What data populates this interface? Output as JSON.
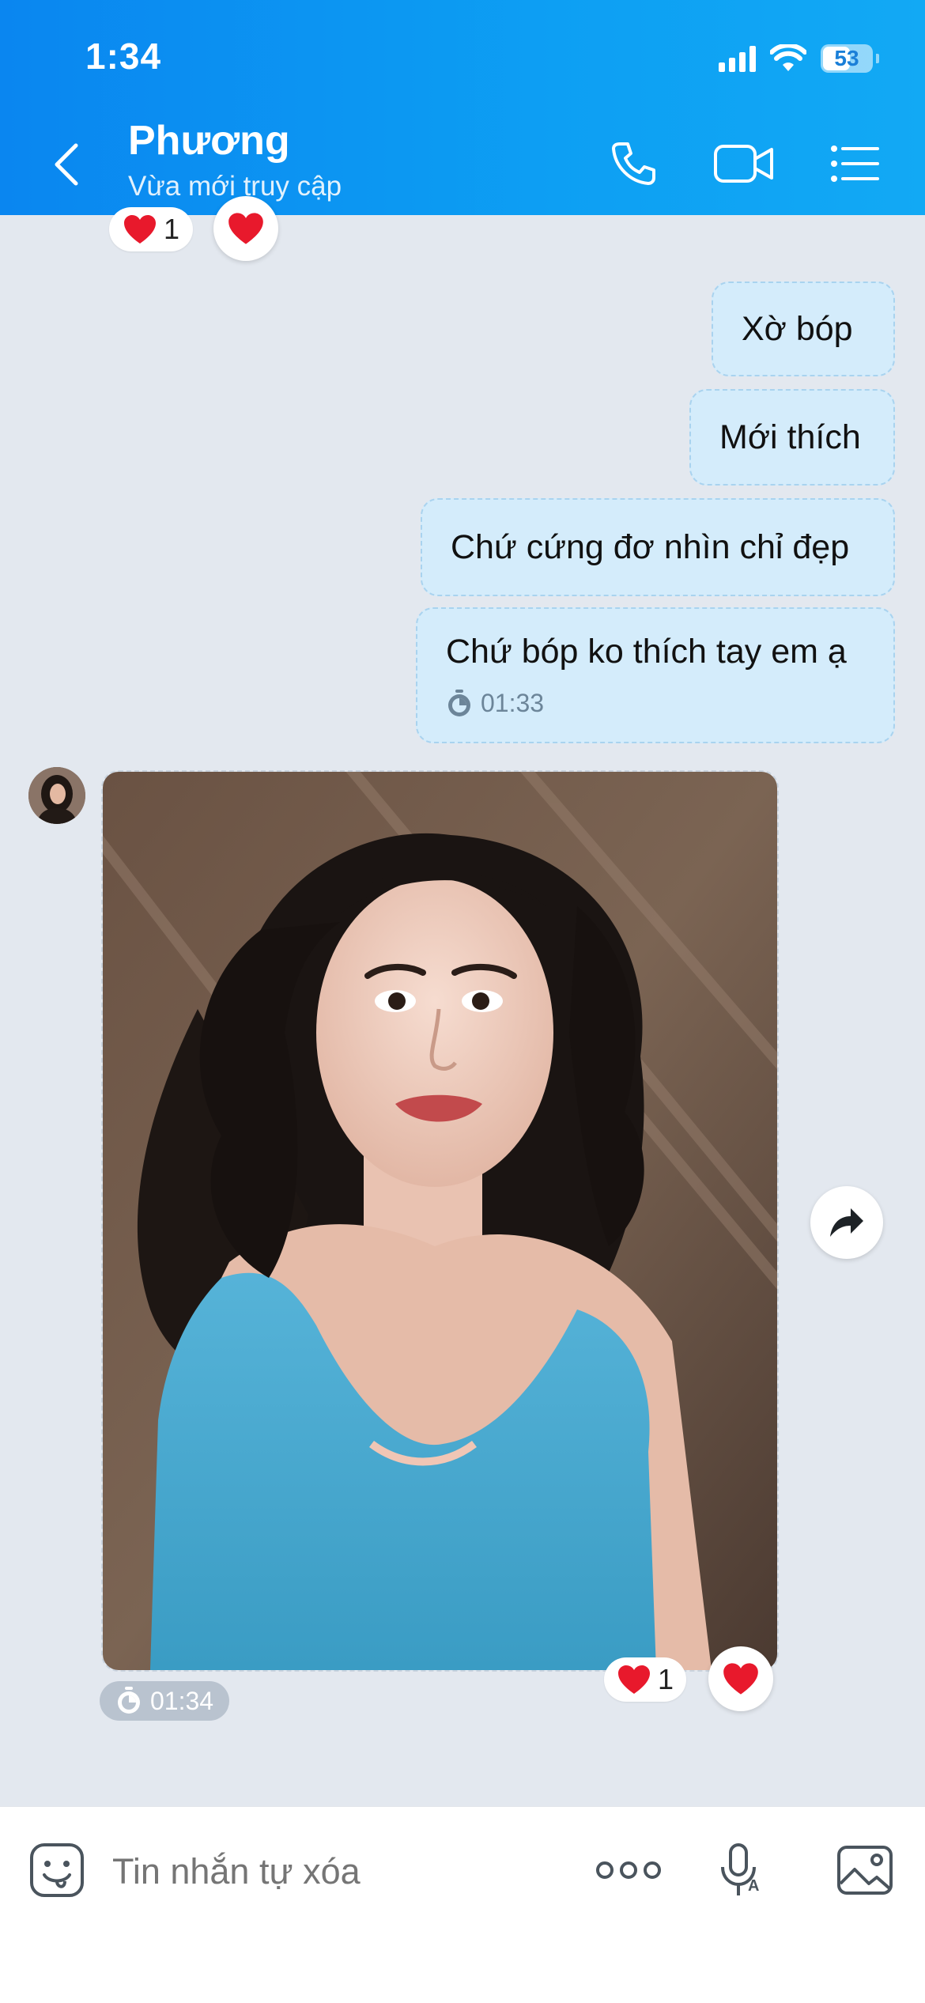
{
  "status_bar": {
    "time": "1:34",
    "battery": "53"
  },
  "header": {
    "contact_name": "Phương",
    "contact_status": "Vừa mới truy cập",
    "icons": [
      "chevron-left-icon",
      "phone-icon",
      "video-camera-icon",
      "list-menu-icon"
    ]
  },
  "reactions": {
    "top_count": "1",
    "photo_count": "1"
  },
  "messages": [
    {
      "direction": "outgoing",
      "text": "Xờ bóp"
    },
    {
      "direction": "outgoing",
      "text": "Mới thích"
    },
    {
      "direction": "outgoing",
      "text": "Chứ cứng đơ nhìn chỉ đẹp"
    },
    {
      "direction": "outgoing",
      "text": "Chứ bóp ko thích tay em ạ",
      "time": "01:33"
    }
  ],
  "photo_message": {
    "direction": "incoming",
    "time": "01:34"
  },
  "composer": {
    "placeholder": "Tin nhắn tự xóa",
    "icons": [
      "sticker-icon",
      "more-icon",
      "voice-to-text-icon",
      "image-icon"
    ]
  },
  "colors": {
    "header": "#0a86f0",
    "outgoing_bubble": "#d4ecfb",
    "background": "#e3e8ef",
    "heart": "#e8192c"
  }
}
